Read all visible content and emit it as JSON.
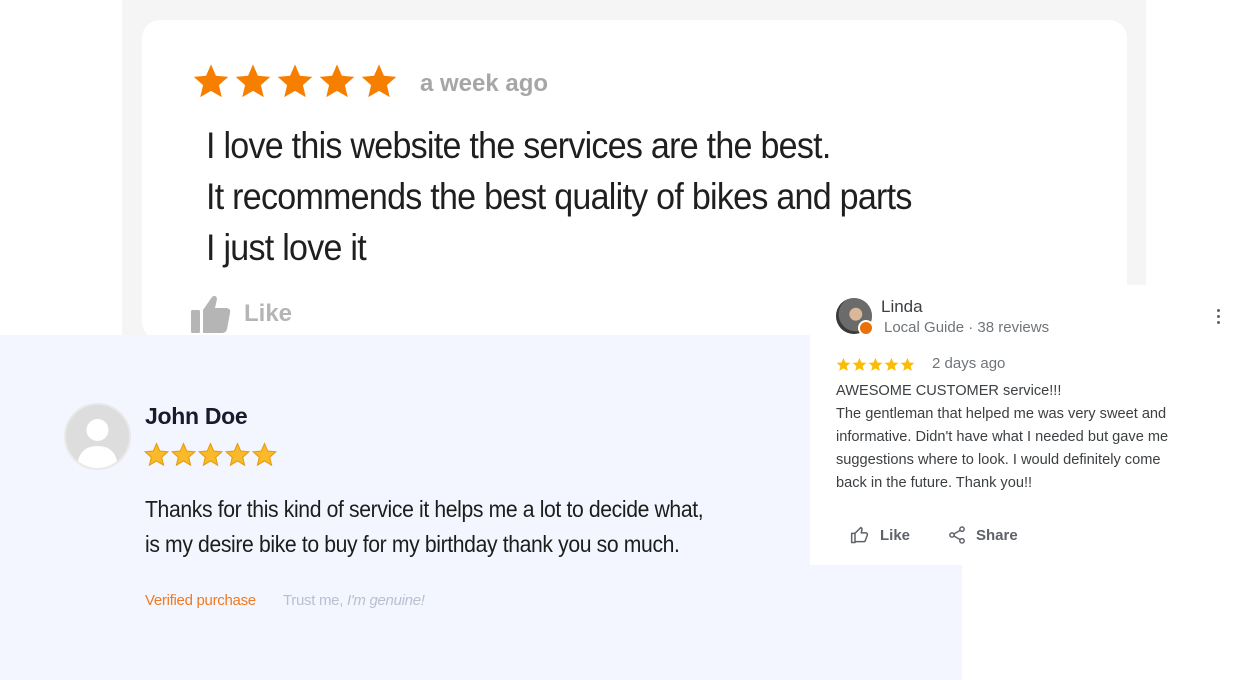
{
  "card1": {
    "rating": 5,
    "time": "a week ago",
    "text_lines": [
      "I love this website the services are the best.",
      "It recommends the best quality of bikes and parts",
      "I just love it"
    ],
    "like_label": "Like",
    "icons": {
      "star": "star-icon",
      "like": "thumbs-up-icon"
    },
    "colors": {
      "star": "#f77f00",
      "muted": "#a6a6a6"
    }
  },
  "card2": {
    "name": "John Doe",
    "rating": 5,
    "text_lines": [
      "Thanks for this kind of service it helps me a lot to decide what,",
      "is my desire bike to buy for my birthday thank you so much."
    ],
    "verified": "Verified purchase",
    "trust_prefix": "Trust me,",
    "trust_italic": "I'm genuine!",
    "icons": {
      "avatar": "user-placeholder-icon",
      "star": "star-icon"
    },
    "colors": {
      "star": "#f9b928",
      "verified": "#f07a23"
    }
  },
  "card3": {
    "name": "Linda",
    "guide": "Local Guide",
    "reviews": "· 38 reviews",
    "rating": 5,
    "time": "2 days ago",
    "text_lines": [
      "AWESOME CUSTOMER service!!!",
      "The gentleman that helped me was very sweet and",
      "informative. Didn't have what I needed but gave me",
      "suggestions where to look. I would definitely come",
      "back in the future. Thank you!!"
    ],
    "like_label": "Like",
    "share_label": "Share",
    "icons": {
      "avatar": "profile-photo",
      "more": "more-vert-icon",
      "like": "thumbs-up-outline-icon",
      "share": "share-icon"
    },
    "colors": {
      "star": "#fbbc04",
      "badge": "#e8710a"
    }
  }
}
